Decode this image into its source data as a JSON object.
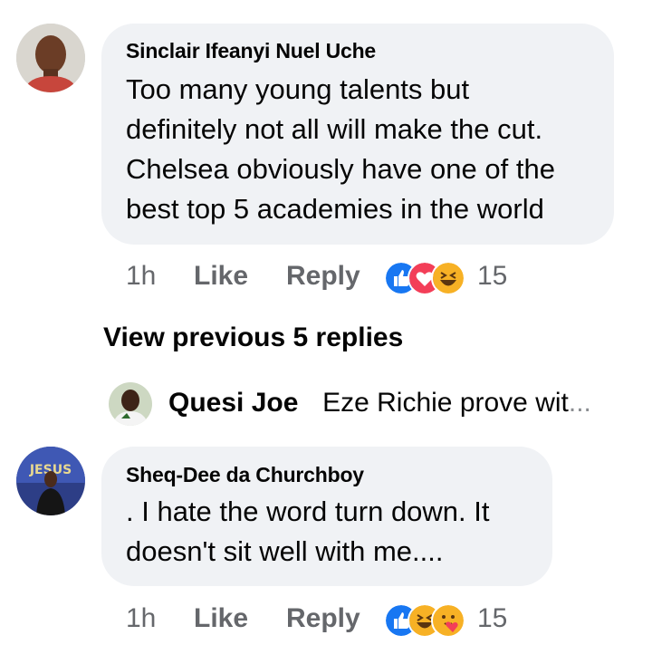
{
  "comments": [
    {
      "author": "Sinclair Ifeanyi Nuel Uche",
      "lines": [
        "Too many young talents but",
        "definitely not all will make the cut.",
        "Chelsea obviously have one of the",
        "best top 5 academies in the world"
      ],
      "time": "1h",
      "like_label": "Like",
      "reply_label": "Reply",
      "reactions": [
        "like-icon",
        "love-icon",
        "haha-icon"
      ],
      "reaction_count": "15"
    },
    {
      "author": "Sheq-Dee da Churchboy",
      "lines": [
        ". I hate the word turn down. It",
        "doesn't sit well with me...."
      ],
      "time": "1h",
      "like_label": "Like",
      "reply_label": "Reply",
      "reactions": [
        "like-icon",
        "haha-icon",
        "care-icon"
      ],
      "reaction_count": "15"
    }
  ],
  "view_previous": "View previous 5 replies",
  "reply_preview": {
    "author": "Quesi Joe",
    "text": "Eze Richie prove wit",
    "ellipsis": "..."
  },
  "colors": {
    "bubble": "#f0f2f5",
    "meta": "#65676b",
    "like_blue": "#1877f2",
    "love_red": "#f33e58",
    "haha_yellow": "#f7b125"
  }
}
